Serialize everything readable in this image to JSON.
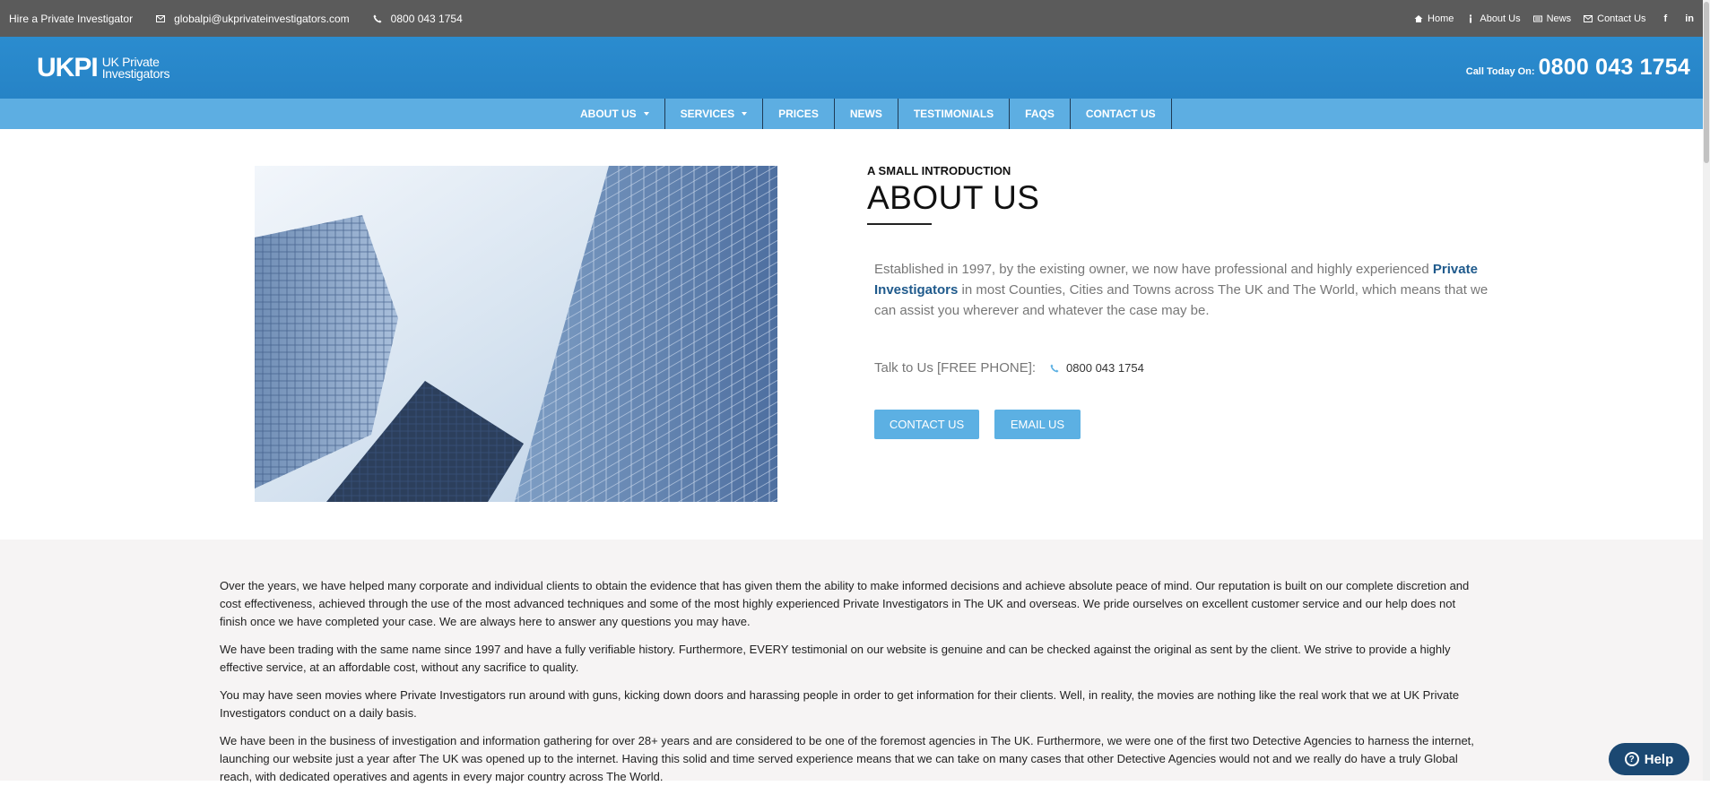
{
  "topbar": {
    "tagline": "Hire a Private Investigator",
    "email": "globalpi@ukprivateinvestigators.com",
    "phone": "0800 043 1754",
    "links": [
      {
        "label": "Home",
        "icon": "home-icon"
      },
      {
        "label": "About Us",
        "icon": "info-icon"
      },
      {
        "label": "News",
        "icon": "newspaper-icon"
      },
      {
        "label": "Contact Us",
        "icon": "envelope-icon"
      }
    ],
    "social": [
      {
        "label": "f",
        "icon": "facebook-icon"
      },
      {
        "label": "in",
        "icon": "linkedin-icon"
      }
    ]
  },
  "header": {
    "logo_mark": "UKPI",
    "logo_line1": "UK Private",
    "logo_line2": "Investigators",
    "call_label": "Call Today On:",
    "call_number": "0800 043 1754"
  },
  "nav": {
    "items": [
      {
        "label": "ABOUT US",
        "dropdown": true
      },
      {
        "label": "SERVICES",
        "dropdown": true
      },
      {
        "label": "PRICES",
        "dropdown": false
      },
      {
        "label": "NEWS",
        "dropdown": false
      },
      {
        "label": "TESTIMONIALS",
        "dropdown": false
      },
      {
        "label": "FAQS",
        "dropdown": false
      },
      {
        "label": "CONTACT US",
        "dropdown": false
      }
    ]
  },
  "intro": {
    "kicker": "A SMALL INTRODUCTION",
    "title": "ABOUT US",
    "para_before": "Established in 1997, by the existing owner, we now have professional and highly experienced ",
    "para_link": "Private Investigators",
    "para_after": " in most Counties, Cities and Towns across The UK and The World, which means that we can assist you wherever and whatever the case may be.",
    "talk_label": "Talk to Us [FREE PHONE]:",
    "talk_phone": "0800 043 1754",
    "contact_button": "CONTACT US",
    "email_button": "EMAIL US"
  },
  "body": {
    "paragraphs": [
      "Over the years, we have helped many corporate and individual clients to obtain the evidence that has given them the ability to make informed decisions and achieve absolute peace of mind. Our reputation is built on our complete discretion and cost effectiveness, achieved through the use of the most advanced techniques and some of the most highly experienced Private Investigators in The UK and overseas. We pride ourselves on excellent customer service and our help does not finish once we have completed your case. We are always here to answer any questions you may have.",
      "We have been trading with the same name since 1997 and have a fully verifiable history. Furthermore, EVERY testimonial on our website is genuine and can be checked against the original as sent by the client. We strive to provide a highly effective service, at an affordable cost, without any sacrifice to quality.",
      "You may have seen movies where Private Investigators run around with guns, kicking down doors and harassing people in order to get information for their clients. Well, in reality, the movies are nothing like the real work that we at UK Private Investigators conduct on a daily basis.",
      "We have been in the business of investigation and information gathering for over 28+ years and are considered to be one of the foremost agencies in The UK. Furthermore, we were one of the first two Detective Agencies to harness the internet, launching our website just a year after The UK was opened up to the internet. Having this solid and time served experience means that we can take on many cases that other Detective Agencies would not and we really do have a truly Global reach, with dedicated operatives and agents in every major country across The World."
    ]
  },
  "help": {
    "label": "Help"
  }
}
